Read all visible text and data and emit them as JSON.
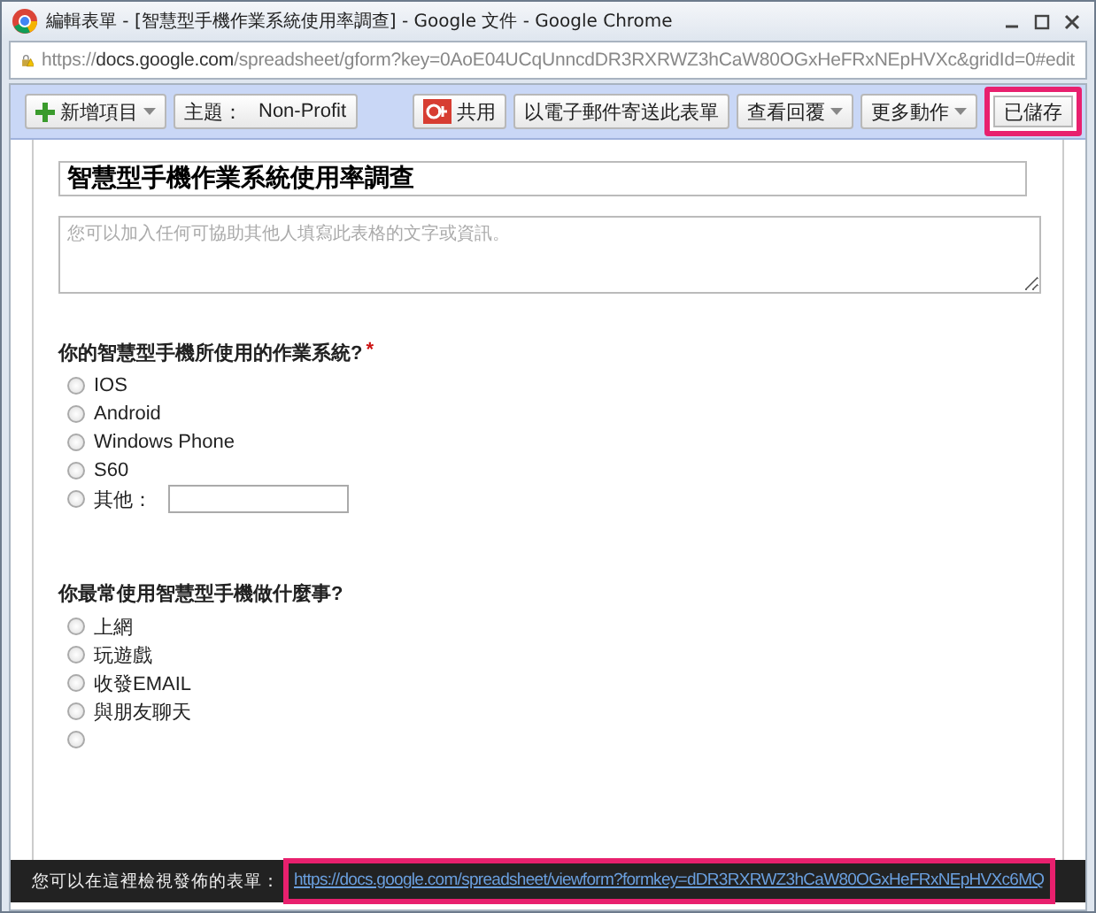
{
  "window": {
    "title": "編輯表單 - [智慧型手機作業系統使用率調查] - Google 文件 - Google Chrome"
  },
  "address_bar": {
    "url": "https://**docs.google.com**/spreadsheet/gform?key=0AoE04UCqUnncdDR3RXRWZ3hCaW80OGxHeFRxNEpHVXc&gridId=0#edit"
  },
  "toolbar": {
    "left": [
      {
        "kind": "add",
        "label": "新增項目"
      },
      {
        "kind": "theme",
        "label": "主題：",
        "value": "Non-Profit"
      }
    ],
    "right": [
      {
        "kind": "share",
        "label": "共用",
        "highlighted": false
      },
      {
        "kind": "button",
        "label": "以電子郵件寄送此表單",
        "highlighted": false
      },
      {
        "kind": "dropdown",
        "label": "查看回覆",
        "highlighted": false
      },
      {
        "kind": "dropdown",
        "label": "更多動作",
        "highlighted": false
      },
      {
        "kind": "button",
        "label": "已儲存",
        "highlighted": true
      }
    ]
  },
  "form": {
    "title": "智慧型手機作業系統使用率調查",
    "description_placeholder": "您可以加入任何可協助其他人填寫此表格的文字或資訊。",
    "questions": [
      {
        "title": "你的智慧型手機所使用的作業系統?",
        "required_mark": "*",
        "options": [
          {
            "kind": "option",
            "label": "IOS",
            "selected": false
          },
          {
            "kind": "option",
            "label": "Android",
            "selected": false
          },
          {
            "kind": "option",
            "label": "Windows Phone",
            "selected": false
          },
          {
            "kind": "option",
            "label": "S60",
            "selected": false
          },
          {
            "kind": "other",
            "label": "其他：",
            "selected": false
          }
        ]
      },
      {
        "title": "你最常使用智慧型手機做什麼事?",
        "options": [
          {
            "kind": "option",
            "label": "上網",
            "selected": false
          },
          {
            "kind": "option",
            "label": "玩遊戲",
            "selected": false
          },
          {
            "kind": "option",
            "label": "收發EMAIL",
            "selected": false
          },
          {
            "kind": "option",
            "label": "與朋友聊天",
            "selected": false
          },
          {
            "kind": "blank",
            "selected": false
          }
        ]
      }
    ]
  },
  "publish_bar": {
    "label": "您可以在這裡檢視發佈的表單：",
    "link": "https://docs.google.com/spreadsheet/viewform?formkey=dDR3RXRWZ3hCaW80OGxHeFRxNEpHVXc6MQ",
    "highlighted": true
  }
}
